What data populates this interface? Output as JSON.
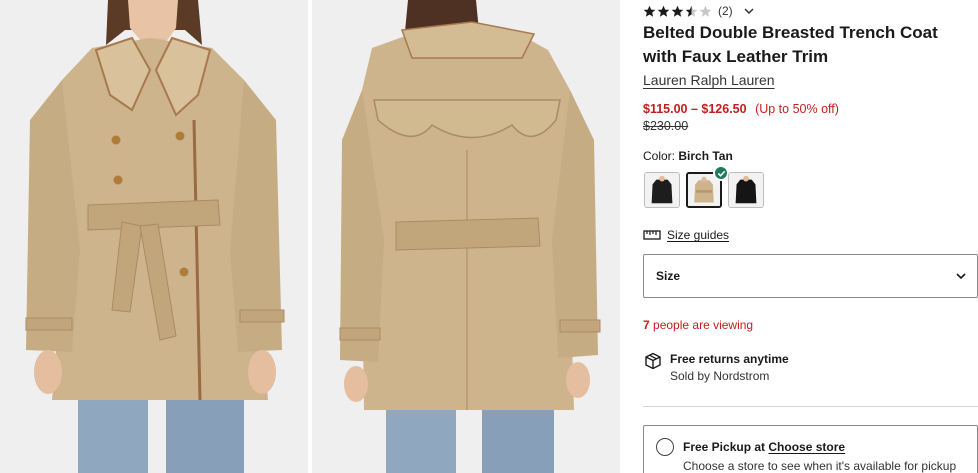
{
  "gallery": {
    "front_image": "front view of belted trench coat on model",
    "back_image": "back view of belted trench coat on model"
  },
  "rating": {
    "stars": 3.5,
    "max_stars": 5,
    "review_count": "(2)"
  },
  "product": {
    "title": "Belted Double Breasted Trench Coat with Faux Leather Trim",
    "brand": "Lauren Ralph Lauren",
    "price_range": "$115.00 – $126.50",
    "discount": "(Up to 50% off)",
    "original_price": "$230.00"
  },
  "color": {
    "label": "Color:",
    "selected": "Birch Tan",
    "swatches": [
      {
        "name": "black-coat",
        "color": "#1d1d1d",
        "selected": false
      },
      {
        "name": "birch-tan-coat",
        "color": "#cdb48c",
        "selected": true
      },
      {
        "name": "black-coat-alt",
        "color": "#151515",
        "selected": false
      }
    ]
  },
  "size": {
    "guides_label": "Size guides",
    "select_label": "Size"
  },
  "viewing": {
    "count": "7",
    "text": "people are viewing"
  },
  "returns": {
    "title": "Free returns anytime",
    "subtitle": "Sold by Nordstrom"
  },
  "pickup": {
    "label": "Free Pickup at",
    "link": "Choose store",
    "subtitle": "Choose a store to see when it's available for pickup"
  },
  "colors": {
    "sale_red": "#c11f1f",
    "check_green": "#1f7a5c",
    "coat_tan": "#cdb48c"
  }
}
